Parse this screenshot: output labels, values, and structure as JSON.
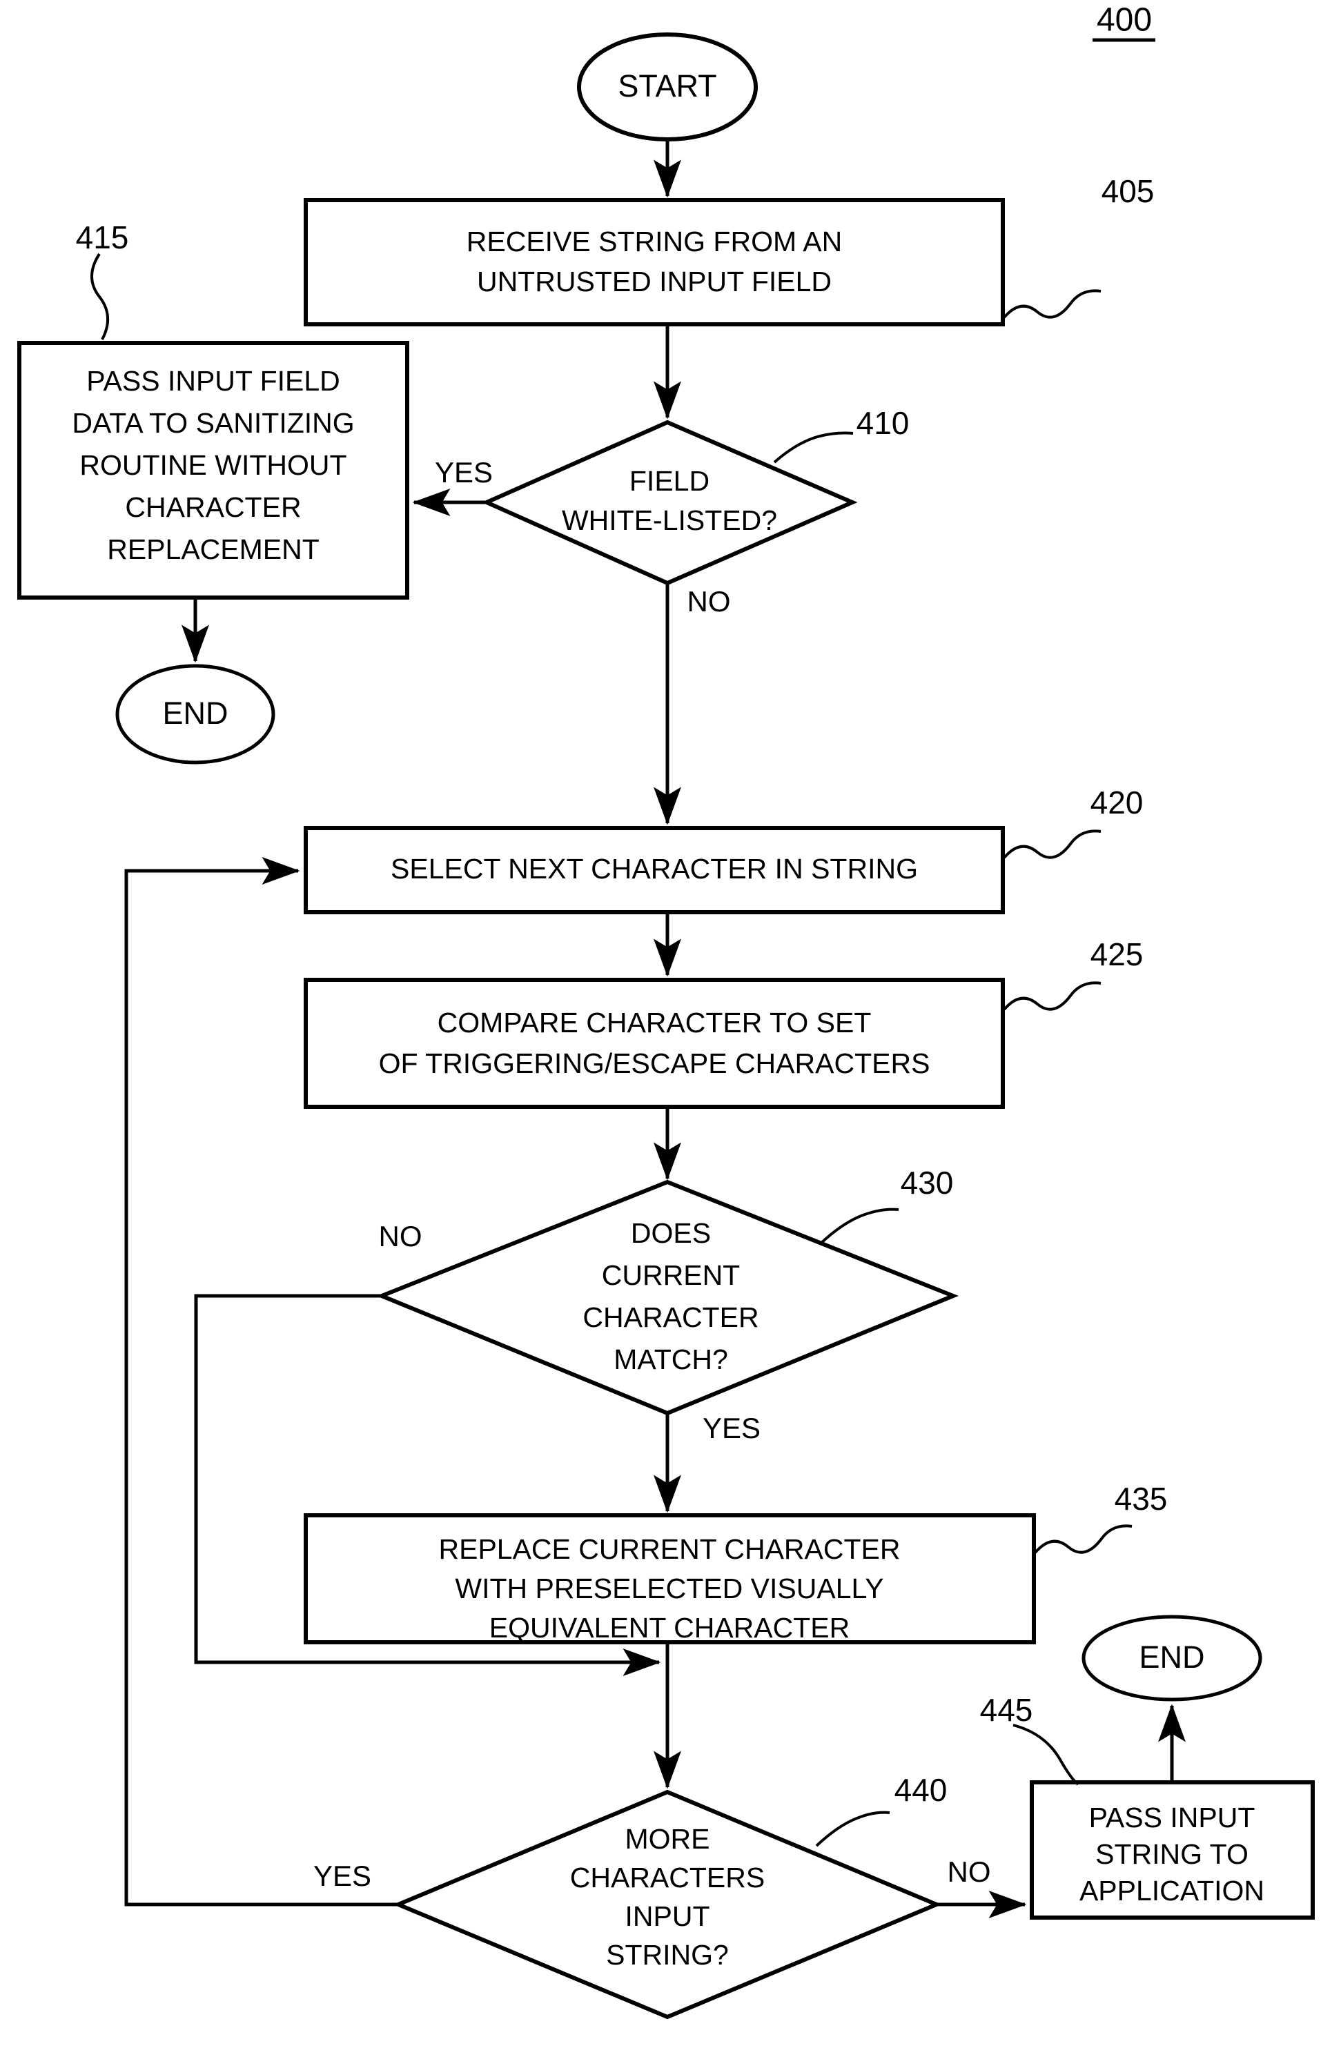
{
  "figure": {
    "number": "400"
  },
  "nodes": {
    "start": {
      "label": "START",
      "shape": "terminator"
    },
    "n405": {
      "ref": "405",
      "shape": "process",
      "lines": [
        "RECEIVE STRING FROM AN",
        "UNTRUSTED INPUT FIELD"
      ]
    },
    "n410": {
      "ref": "410",
      "shape": "decision",
      "lines": [
        "FIELD",
        "WHITE-LISTED?"
      ]
    },
    "n415": {
      "ref": "415",
      "shape": "process",
      "lines": [
        "PASS INPUT FIELD",
        "DATA TO SANITIZING",
        "ROUTINE WITHOUT",
        "CHARACTER",
        "REPLACEMENT"
      ]
    },
    "end_left": {
      "label": "END",
      "shape": "terminator"
    },
    "n420": {
      "ref": "420",
      "shape": "process",
      "lines": [
        "SELECT NEXT CHARACTER IN STRING"
      ]
    },
    "n425": {
      "ref": "425",
      "shape": "process",
      "lines": [
        "COMPARE CHARACTER TO SET",
        "OF TRIGGERING/ESCAPE CHARACTERS"
      ]
    },
    "n430": {
      "ref": "430",
      "shape": "decision",
      "lines": [
        "DOES",
        "CURRENT",
        "CHARACTER",
        "MATCH?"
      ]
    },
    "n435": {
      "ref": "435",
      "shape": "process",
      "lines": [
        "REPLACE CURRENT CHARACTER",
        "WITH PRESELECTED VISUALLY",
        "EQUIVALENT CHARACTER"
      ]
    },
    "n440": {
      "ref": "440",
      "shape": "decision",
      "lines": [
        "MORE",
        "CHARACTERS",
        "INPUT",
        "STRING?"
      ]
    },
    "n445": {
      "ref": "445",
      "shape": "process",
      "lines": [
        "PASS INPUT",
        "STRING TO",
        "APPLICATION"
      ]
    },
    "end_right": {
      "label": "END",
      "shape": "terminator"
    }
  },
  "branch_labels": {
    "yes_410": "YES",
    "no_410": "NO",
    "no_430": "NO",
    "yes_430": "YES",
    "yes_440": "YES",
    "no_440": "NO"
  },
  "colors": {
    "stroke": "#000000",
    "fill": "#ffffff",
    "background": "#ffffff"
  }
}
